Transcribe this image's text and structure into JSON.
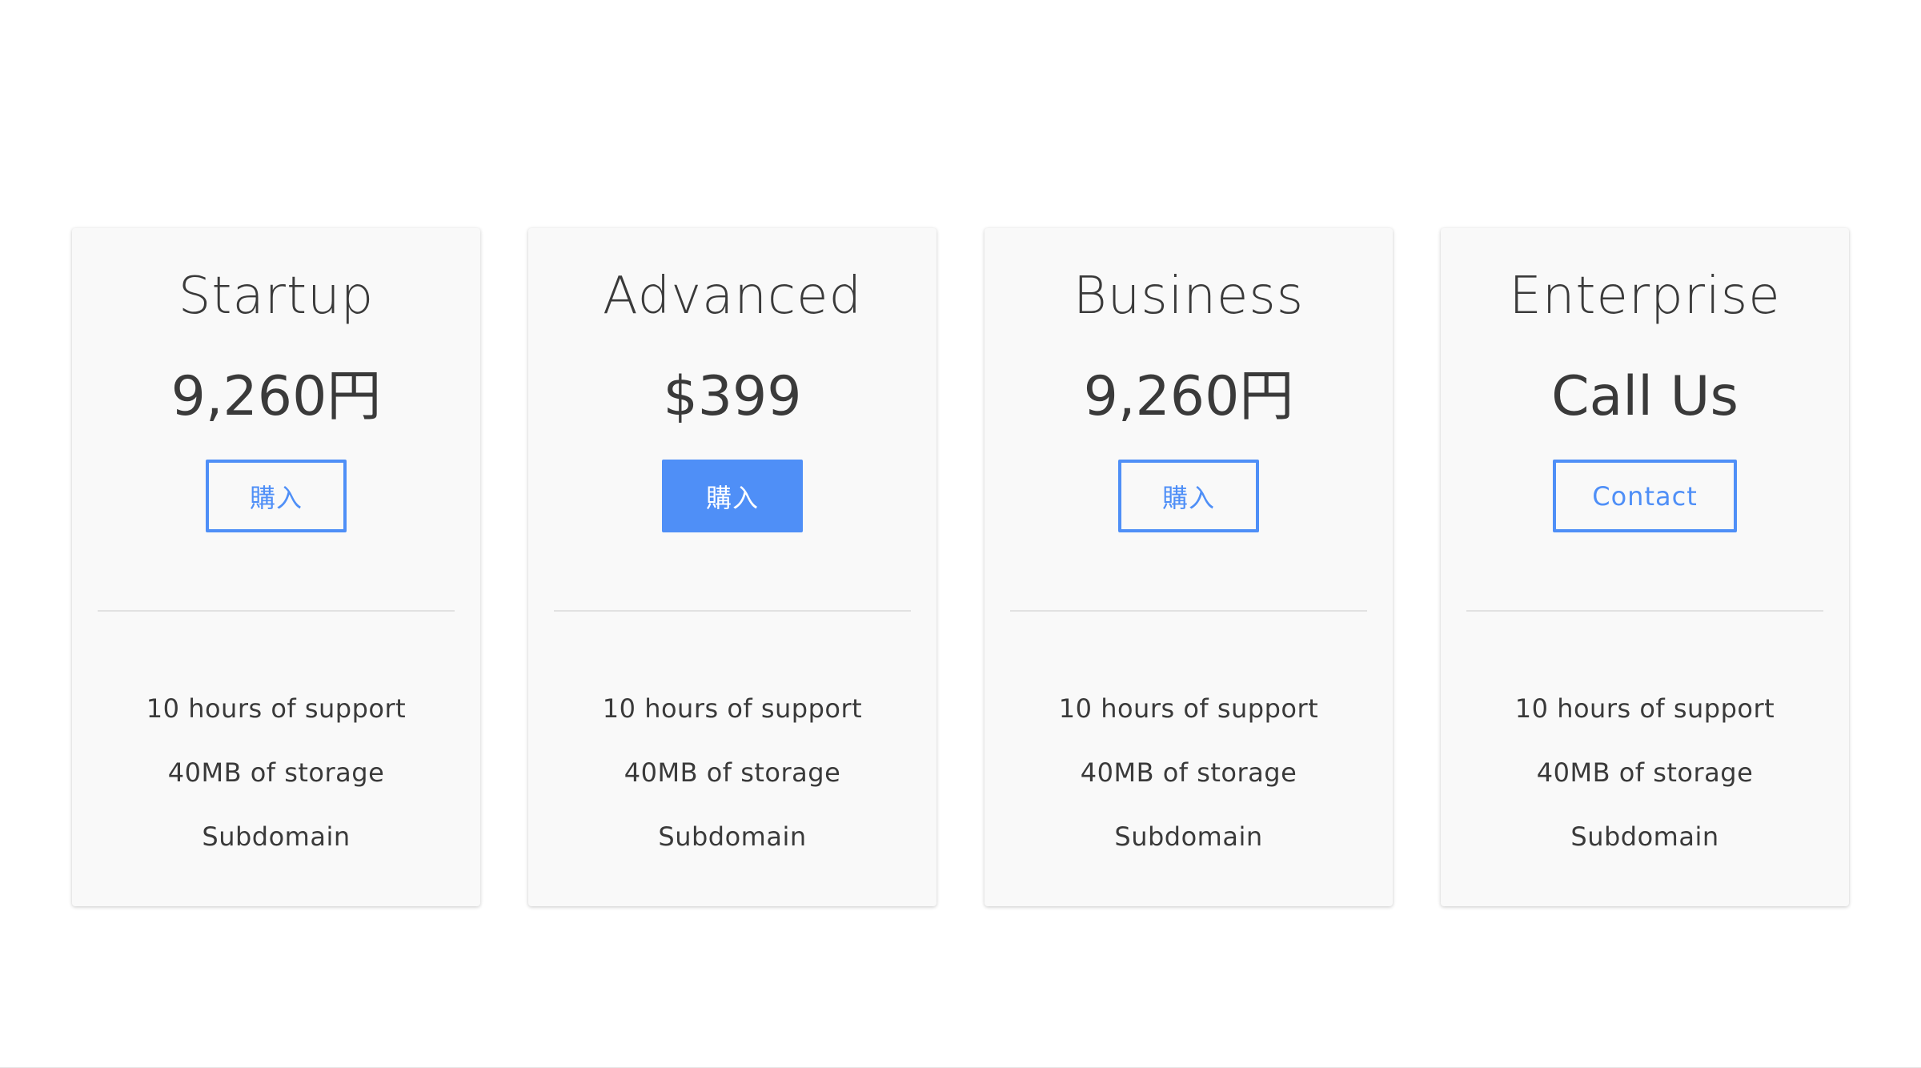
{
  "plans": [
    {
      "name": "Startup",
      "price": "9,260円",
      "button_label": "購入",
      "button_style": "outline",
      "features": [
        "10 hours of support",
        "40MB of storage",
        "Subdomain"
      ]
    },
    {
      "name": "Advanced",
      "price": "$399",
      "button_label": "購入",
      "button_style": "filled",
      "features": [
        "10 hours of support",
        "40MB of storage",
        "Subdomain"
      ]
    },
    {
      "name": "Business",
      "price": "9,260円",
      "button_label": "購入",
      "button_style": "outline",
      "features": [
        "10 hours of support",
        "40MB of storage",
        "Subdomain"
      ]
    },
    {
      "name": "Enterprise",
      "price": "Call Us",
      "button_label": "Contact",
      "button_style": "outline",
      "features": [
        "10 hours of support",
        "40MB of storage",
        "Subdomain"
      ]
    }
  ],
  "colors": {
    "accent": "#4f8ff7",
    "card_background": "#f9f9f9",
    "text": "#3a3a3a",
    "page_background": "#ffffff"
  }
}
